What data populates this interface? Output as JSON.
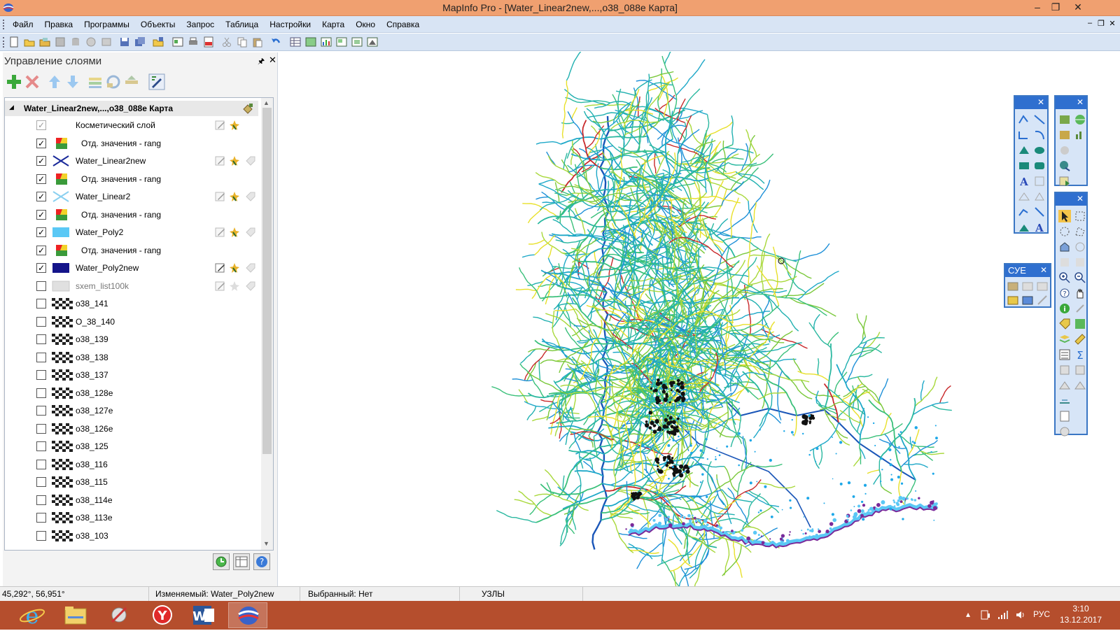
{
  "window": {
    "title": "MapInfo Pro - [Water_Linear2new,...,o38_088e Карта]",
    "controls": [
      "–",
      "❐",
      "✕"
    ],
    "mdi_controls": [
      "–",
      "❐",
      "✕"
    ]
  },
  "menu": [
    "Файл",
    "Правка",
    "Программы",
    "Объекты",
    "Запрос",
    "Таблица",
    "Настройки",
    "Карта",
    "Окно",
    "Справка"
  ],
  "layer_panel": {
    "title": "Управление слоями",
    "pin": "🖈",
    "close": "✕",
    "root_label": "Water_Linear2new,...,o38_088e Карта",
    "layers": [
      {
        "label": "Косметический слой",
        "checked": true,
        "disabled": true,
        "icon": "cosmetic-layer-icon",
        "sub": false
      },
      {
        "label": "Отд. значения - rang",
        "checked": true,
        "icon": "thematic-map-icon",
        "sub": true
      },
      {
        "label": "Water_Linear2new",
        "checked": true,
        "icon": "line-layer-dark-icon",
        "sub": false
      },
      {
        "label": "Отд. значения - rang",
        "checked": true,
        "icon": "thematic-map-icon",
        "sub": true
      },
      {
        "label": "Water_Linear2",
        "checked": true,
        "icon": "line-layer-light-icon",
        "sub": false
      },
      {
        "label": "Отд. значения - rang",
        "checked": true,
        "icon": "thematic-map-icon",
        "sub": true
      },
      {
        "label": "Water_Poly2",
        "checked": true,
        "icon": "polygon-layer-light-icon",
        "sub": false
      },
      {
        "label": "Отд. значения - rang",
        "checked": true,
        "icon": "thematic-map-icon",
        "sub": true
      },
      {
        "label": "Water_Poly2new",
        "checked": true,
        "icon": "polygon-layer-dark-icon",
        "sub": false
      },
      {
        "label": "sxem_list100k",
        "checked": false,
        "icon": "polygon-layer-grey-icon",
        "sub": false,
        "dim": true
      },
      {
        "label": "o38_141",
        "checked": false,
        "icon": "raster-layer-icon",
        "sub": false
      },
      {
        "label": "O_38_140",
        "checked": false,
        "icon": "raster-layer-icon",
        "sub": false
      },
      {
        "label": "o38_139",
        "checked": false,
        "icon": "raster-layer-icon",
        "sub": false
      },
      {
        "label": "o38_138",
        "checked": false,
        "icon": "raster-layer-icon",
        "sub": false
      },
      {
        "label": "o38_137",
        "checked": false,
        "icon": "raster-layer-icon",
        "sub": false
      },
      {
        "label": "o38_128e",
        "checked": false,
        "icon": "raster-layer-icon",
        "sub": false
      },
      {
        "label": "o38_127e",
        "checked": false,
        "icon": "raster-layer-icon",
        "sub": false
      },
      {
        "label": "o38_126e",
        "checked": false,
        "icon": "raster-layer-icon",
        "sub": false
      },
      {
        "label": "o38_125",
        "checked": false,
        "icon": "raster-layer-icon",
        "sub": false
      },
      {
        "label": "o38_116",
        "checked": false,
        "icon": "raster-layer-icon",
        "sub": false
      },
      {
        "label": "o38_115",
        "checked": false,
        "icon": "raster-layer-icon",
        "sub": false
      },
      {
        "label": "o38_114e",
        "checked": false,
        "icon": "raster-layer-icon",
        "sub": false
      },
      {
        "label": "o38_113e",
        "checked": false,
        "icon": "raster-layer-icon",
        "sub": false
      },
      {
        "label": "o38_103",
        "checked": false,
        "icon": "raster-layer-icon",
        "sub": false
      }
    ]
  },
  "palettes": {
    "cye_title": "СУЕ"
  },
  "status": {
    "coords": "45,292°, 56,951°",
    "editable": "Изменяемый: Water_Poly2new",
    "selected": "Выбранный: Нет",
    "mode": "УЗЛЫ"
  },
  "taskbar": {
    "lang": "РУС",
    "time": "3:10",
    "date": "13.12.2017"
  },
  "colors": {
    "titlebar": "#f0a070",
    "menubar": "#d8e4f4",
    "taskbar": "#b54e2d",
    "palette_header": "#2f6fcf"
  }
}
